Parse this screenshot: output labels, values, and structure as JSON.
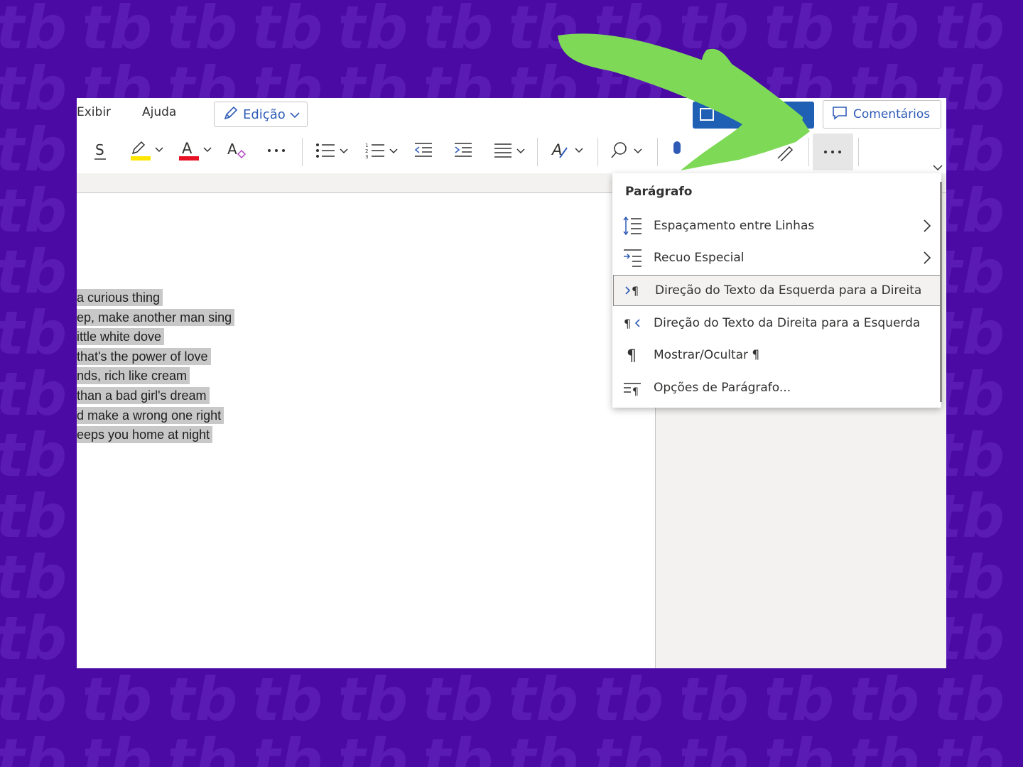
{
  "ribbon_tabs": {
    "view": "Exibir",
    "help": "Ajuda"
  },
  "edit_mode": {
    "label": "Edição"
  },
  "comments": {
    "label": "Comentários"
  },
  "colors": {
    "background": "#4a0aa3",
    "highlight": "#ffe600",
    "font_color": "#e81123",
    "accent_blue": "#2f5bb7",
    "arrow_green": "#7ed957"
  },
  "toolbar_icons": [
    "strikethrough-icon",
    "highlight-icon",
    "font-color-icon",
    "clear-format-icon",
    "more-font-icon",
    "bullets-icon",
    "numbering-icon",
    "decrease-indent-icon",
    "increase-indent-icon",
    "align-icon",
    "styles-icon",
    "find-icon",
    "dictate-icon",
    "comment-icon",
    "editor-icon",
    "more-options-icon"
  ],
  "document": {
    "lines": [
      "a curious thing",
      "ep, make another man sing",
      "ittle white dove",
      " that's the power of love",
      "nds, rich like cream",
      "than a bad girl's dream",
      "d make a wrong one right",
      "eeps you home at night"
    ]
  },
  "menu": {
    "title": "Parágrafo",
    "items": [
      {
        "label": "Espaçamento entre Linhas",
        "icon": "line-spacing-icon",
        "submenu": true
      },
      {
        "label": "Recuo Especial",
        "icon": "special-indent-icon",
        "submenu": true
      },
      {
        "label": "Direção do Texto da Esquerda para a Direita",
        "icon": "ltr-paragraph-icon",
        "submenu": false,
        "selected": true
      },
      {
        "label": "Direção do Texto da Direita para a Esquerda",
        "icon": "rtl-paragraph-icon",
        "submenu": false
      },
      {
        "label": "Mostrar/Ocultar ¶",
        "icon": "pilcrow-icon",
        "submenu": false
      },
      {
        "label": "Opções de Parágrafo...",
        "icon": "paragraph-options-icon",
        "submenu": false
      }
    ]
  }
}
